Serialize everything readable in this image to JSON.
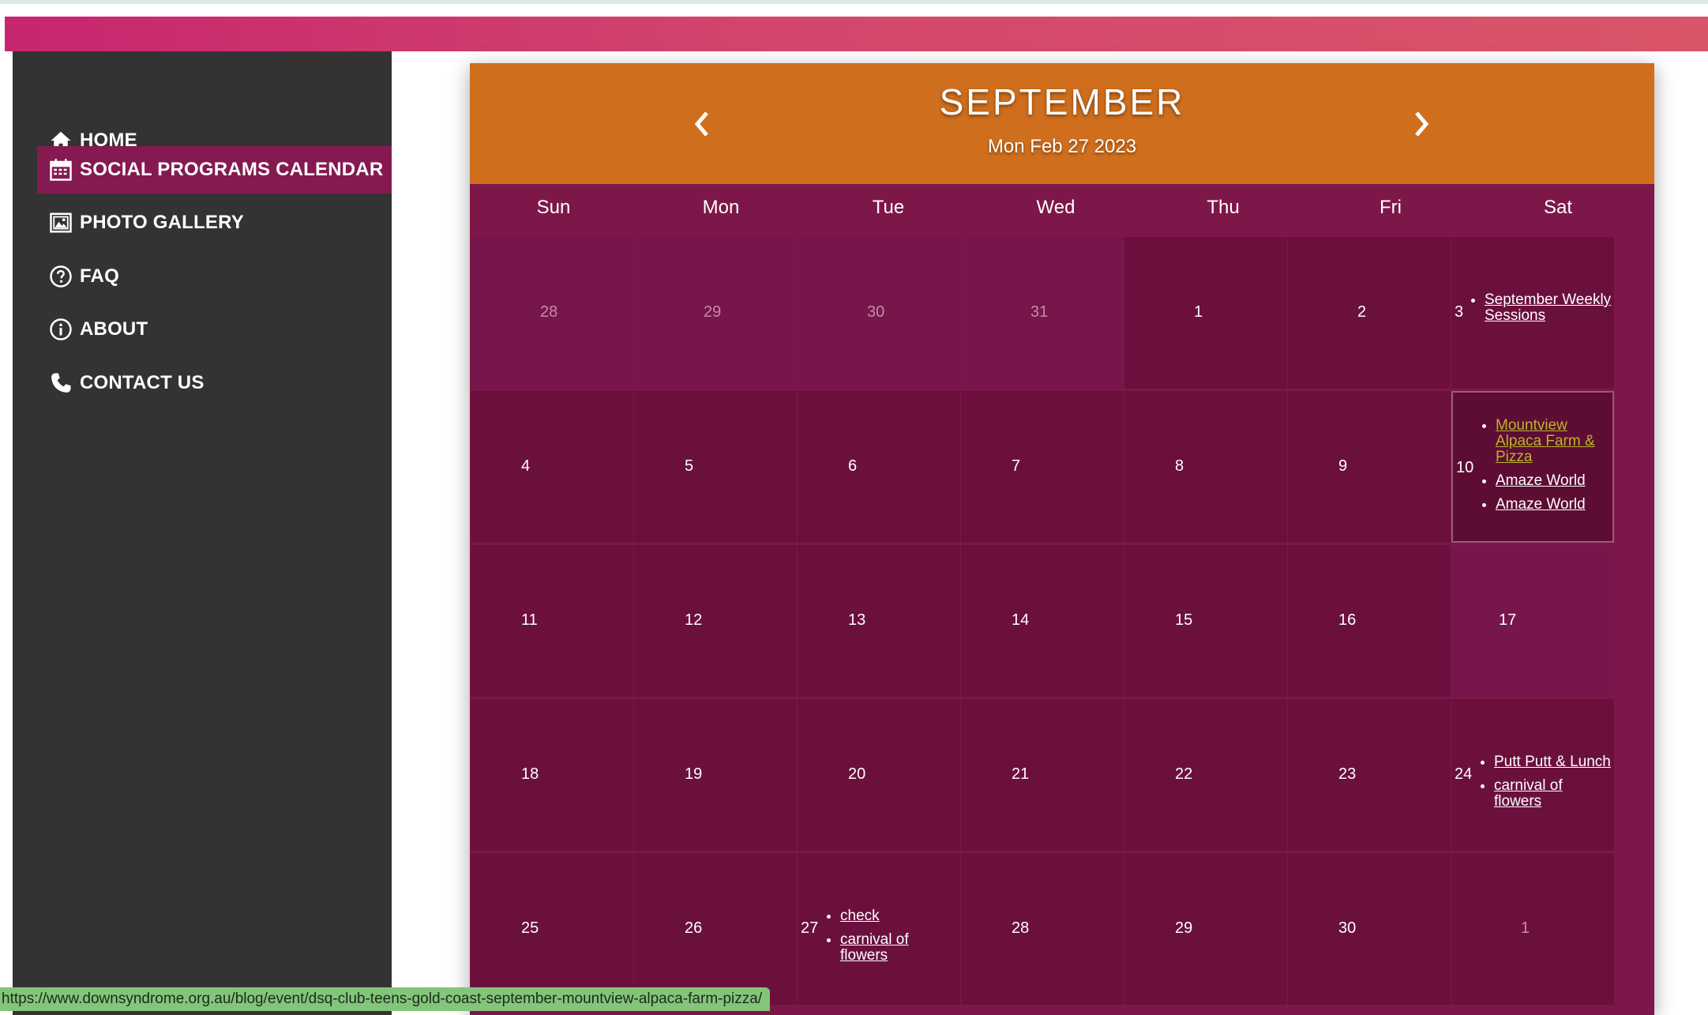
{
  "nav": {
    "items": [
      {
        "label": "HOME",
        "icon": "home-icon"
      },
      {
        "label": "SOCIAL PROGRAMS CALENDAR",
        "icon": "calendar-icon"
      },
      {
        "label": "PHOTO GALLERY",
        "icon": "image-icon"
      },
      {
        "label": "FAQ",
        "icon": "question-icon"
      },
      {
        "label": "ABOUT",
        "icon": "info-icon"
      },
      {
        "label": "CONTACT US",
        "icon": "phone-icon"
      }
    ]
  },
  "calendar": {
    "month": "SEPTEMBER",
    "current_date": "Mon Feb 27 2023",
    "weekdays": [
      "Sun",
      "Mon",
      "Tue",
      "Wed",
      "Thu",
      "Fri",
      "Sat"
    ],
    "weeks": [
      [
        {
          "day": "28",
          "other": true
        },
        {
          "day": "29",
          "other": true
        },
        {
          "day": "30",
          "other": true
        },
        {
          "day": "31",
          "other": true
        },
        {
          "day": "1"
        },
        {
          "day": "2"
        },
        {
          "day": "3",
          "events": [
            "September Weekly Sessions"
          ]
        }
      ],
      [
        {
          "day": "4"
        },
        {
          "day": "5"
        },
        {
          "day": "6"
        },
        {
          "day": "7"
        },
        {
          "day": "8"
        },
        {
          "day": "9"
        },
        {
          "day": "10",
          "selected": true,
          "events": [
            "Mountview Alpaca Farm & Pizza",
            "Amaze World",
            "Amaze World"
          ]
        }
      ],
      [
        {
          "day": "11"
        },
        {
          "day": "12"
        },
        {
          "day": "13"
        },
        {
          "day": "14"
        },
        {
          "day": "15"
        },
        {
          "day": "16"
        },
        {
          "day": "17"
        }
      ],
      [
        {
          "day": "18"
        },
        {
          "day": "19"
        },
        {
          "day": "20"
        },
        {
          "day": "21"
        },
        {
          "day": "22"
        },
        {
          "day": "23"
        },
        {
          "day": "24",
          "events": [
            "Putt Putt & Lunch",
            "carnival of flowers"
          ]
        }
      ],
      [
        {
          "day": "25"
        },
        {
          "day": "26"
        },
        {
          "day": "27",
          "events": [
            "check",
            "carnival of flowers"
          ]
        },
        {
          "day": "28"
        },
        {
          "day": "29"
        },
        {
          "day": "30"
        },
        {
          "day": "1",
          "other": true
        }
      ]
    ]
  },
  "status_url": "https://www.downsyndrome.org.au/blog/event/dsq-club-teens-gold-coast-september-mountview-alpaca-farm-pizza/",
  "colors": {
    "topbar": "#c8256f",
    "sidebar": "#333333",
    "nav_active": "#841a50",
    "calendar_header": "#cf6e1c",
    "calendar_body": "#7e1749",
    "cell": "#6b103d",
    "visited_link": "#b9b52a",
    "status_bar": "#83c57a"
  }
}
